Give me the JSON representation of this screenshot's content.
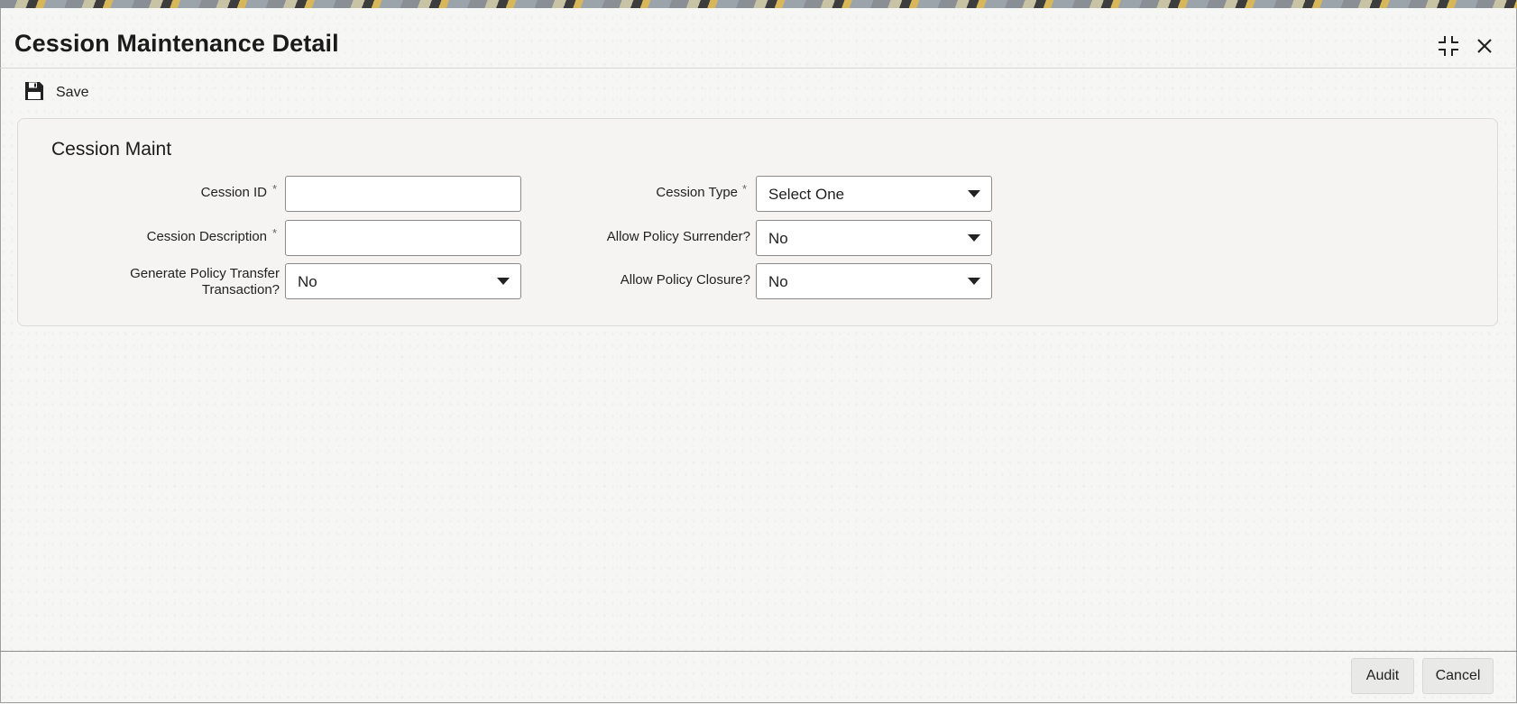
{
  "window": {
    "title": "Cession Maintenance Detail"
  },
  "toolbar": {
    "save_label": "Save"
  },
  "section": {
    "title": "Cession Maint"
  },
  "fields": {
    "cession_id": {
      "label": "Cession ID",
      "value": "",
      "required_mark": "*"
    },
    "cession_description": {
      "label": "Cession Description",
      "value": "",
      "required_mark": "*"
    },
    "generate_policy_transfer": {
      "label_line1": "Generate Policy Transfer",
      "label_line2": "Transaction?",
      "value": "No"
    },
    "cession_type": {
      "label": "Cession Type",
      "value": "Select One",
      "required_mark": "*"
    },
    "allow_policy_surrender": {
      "label": "Allow Policy Surrender?",
      "value": "No"
    },
    "allow_policy_closure": {
      "label": "Allow Policy Closure?",
      "value": "No"
    }
  },
  "footer": {
    "audit_label": "Audit",
    "cancel_label": "Cancel"
  },
  "colors": {
    "background": "#f6f6f4",
    "panel": "#f5f4f2",
    "button": "#e9e9e7"
  },
  "icons": {
    "save": "floppy-disk-icon",
    "restore": "restore-window-icon",
    "close": "close-icon",
    "dropdown": "chevron-down-icon"
  }
}
